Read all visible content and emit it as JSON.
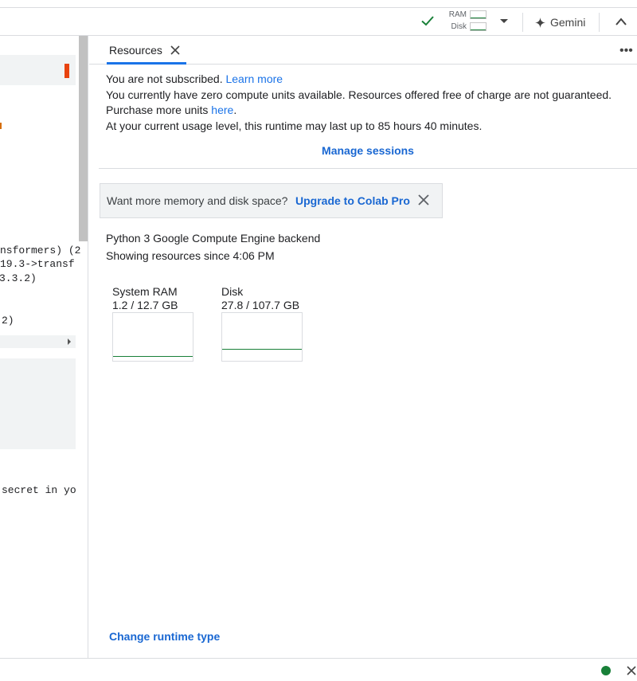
{
  "toolbar": {
    "ram_label": "RAM",
    "disk_label": "Disk",
    "ram_usage_fraction": 0.09,
    "disk_usage_fraction": 0.26,
    "gemini_label": "Gemini"
  },
  "notebook": {
    "output_lines": [
      "nsformers) (2",
      "19.3->transf",
      "3.3.2)",
      "2)",
      "secret in yo"
    ]
  },
  "panel": {
    "tab_label": "Resources",
    "subscription": {
      "text": "You are not subscribed.",
      "link": "Learn more"
    },
    "compute_units": {
      "line1": "You currently have zero compute units available. Resources offered free of charge are not guaranteed.",
      "line2_prefix": "Purchase more units",
      "line2_link": "here",
      "line2_suffix": "."
    },
    "usage_text": "At your current usage level, this runtime may last up to 85 hours 40 minutes.",
    "manage_sessions": "Manage sessions",
    "upsell": {
      "text": "Want more memory and disk space?",
      "link": "Upgrade to Colab Pro"
    },
    "backend": "Python 3 Google Compute Engine backend",
    "since": "Showing resources since 4:06 PM",
    "gauges": [
      {
        "title": "System RAM",
        "value": "1.2 / 12.7 GB",
        "used_fraction": 0.094
      },
      {
        "title": "Disk",
        "value": "27.8 / 107.7 GB",
        "used_fraction": 0.258
      }
    ],
    "change_runtime": "Change runtime type"
  },
  "colors": {
    "accent": "#1a73e8",
    "ok_green": "#188038",
    "error_red": "#e8430f"
  }
}
